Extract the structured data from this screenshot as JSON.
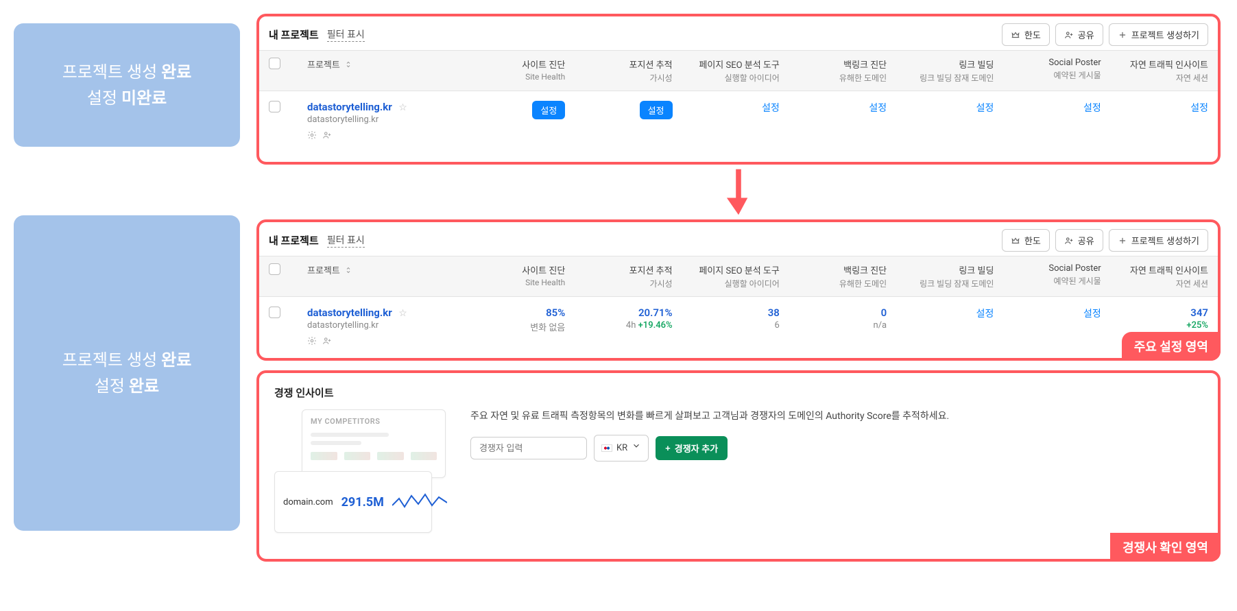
{
  "left_labels": {
    "box1_line1_pre": "프로젝트 생성 ",
    "box1_line1_bold": "완료",
    "box1_line2_pre": "설정 ",
    "box1_line2_bold": "미완료",
    "box2_line1_pre": "프로젝트 생성 ",
    "box2_line1_bold": "완료",
    "box2_line2_pre": "설정 ",
    "box2_line2_bold": "완료"
  },
  "panel_header": {
    "title": "내 프로젝트",
    "filter_label": "필터 표시",
    "btn_limit": "한도",
    "btn_share": "공유",
    "btn_create": "프로젝트 생성하기"
  },
  "columns": {
    "project": "프로젝트",
    "c1": {
      "primary": "사이트 진단",
      "sub": "Site Health"
    },
    "c2": {
      "primary": "포지션 추적",
      "sub": "가시성"
    },
    "c3": {
      "primary": "페이지 SEO 분석 도구",
      "sub": "실행할 아이디어"
    },
    "c4": {
      "primary": "백링크 진단",
      "sub": "유해한 도메인"
    },
    "c5": {
      "primary": "링크 빌딩",
      "sub": "링크 빌딩 잠재 도메인"
    },
    "c6": {
      "primary": "Social Poster",
      "sub": "예약된 게시물"
    },
    "c7": {
      "primary": "자연 트래픽 인사이트",
      "sub": "자연 세션"
    }
  },
  "row_top": {
    "name": "datastorytelling.kr",
    "domain": "datastorytelling.kr",
    "setup_label": "설정"
  },
  "row_bottom": {
    "name": "datastorytelling.kr",
    "domain": "datastorytelling.kr",
    "c1_value": "85%",
    "c1_sub": "변화 없음",
    "c2_value": "20.71%",
    "c2_sub_prefix": "4h ",
    "c2_sub_change": "+19.46%",
    "c3_value": "38",
    "c3_sub": "6",
    "c4_value": "0",
    "c4_sub": "n/a",
    "c5_link": "설정",
    "c6_link": "설정",
    "c7_value": "347",
    "c7_sub": "+25%"
  },
  "tags": {
    "main_settings": "주요 설정 영역",
    "competitor_area": "경쟁사 확인 영역"
  },
  "insight": {
    "title": "경쟁 인사이트",
    "mock_header": "MY COMPETITORS",
    "mock_domain": "domain.com",
    "mock_number": "291.5M",
    "desc": "주요 자연 및 유료 트래픽 측정항목의 변화를 빠르게 살펴보고 고객님과 경쟁자의 도메인의 Authority Score를 추적하세요.",
    "input_placeholder": "경쟁자 입력",
    "country": "KR",
    "add_btn": "경쟁자 추가"
  }
}
